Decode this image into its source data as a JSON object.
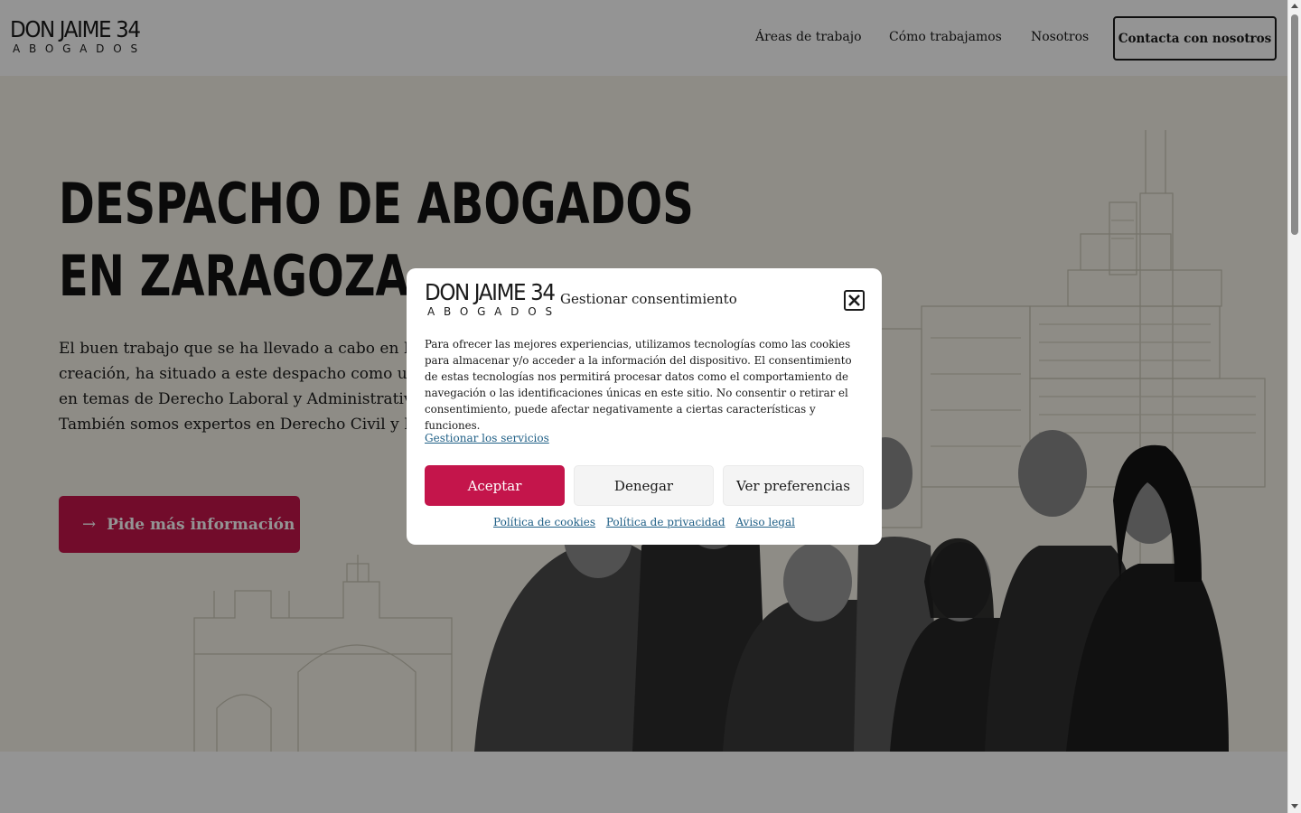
{
  "brand": {
    "logo_main": "DON JAIME 34",
    "logo_sub": "ABOGADOS"
  },
  "nav": {
    "items": [
      {
        "label": "Áreas de trabajo"
      },
      {
        "label": "Cómo trabajamos"
      },
      {
        "label": "Nosotros"
      }
    ],
    "cta_label": "Contacta con nosotros"
  },
  "hero": {
    "title_line1": "DESPACHO DE ABOGADOS",
    "title_line2": "EN ZARAGOZA",
    "text_lines": [
      "El buen trabajo que se ha llevado a cabo en Don",
      "creación, ha situado a este despacho como una",
      "en temas de Derecho Laboral y Administrativo.",
      "También somos expertos en Derecho Civil y Pe"
    ],
    "button_label": "Pide más información",
    "button_icon": "arrow-right-icon"
  },
  "consent": {
    "title": "Gestionar consentimiento",
    "body": "Para ofrecer las mejores experiencias, utilizamos tecnologías como las cookies para almacenar y/o acceder a la información del dispositivo. El consentimiento de estas tecnologías nos permitirá procesar datos como el comportamiento de navegación o las identificaciones únicas en este sitio. No consentir o retirar el consentimiento, puede afectar negativamente a ciertas características y funciones.",
    "manage_link": "Gestionar los servicios",
    "accept_label": "Aceptar",
    "deny_label": "Denegar",
    "prefs_label": "Ver preferencias",
    "links": [
      "Política de cookies",
      "Política de privacidad",
      "Aviso legal"
    ]
  },
  "colors": {
    "accent": "#c4154b",
    "link": "#1f5f86",
    "hero_bg": "#f4f1e7"
  }
}
